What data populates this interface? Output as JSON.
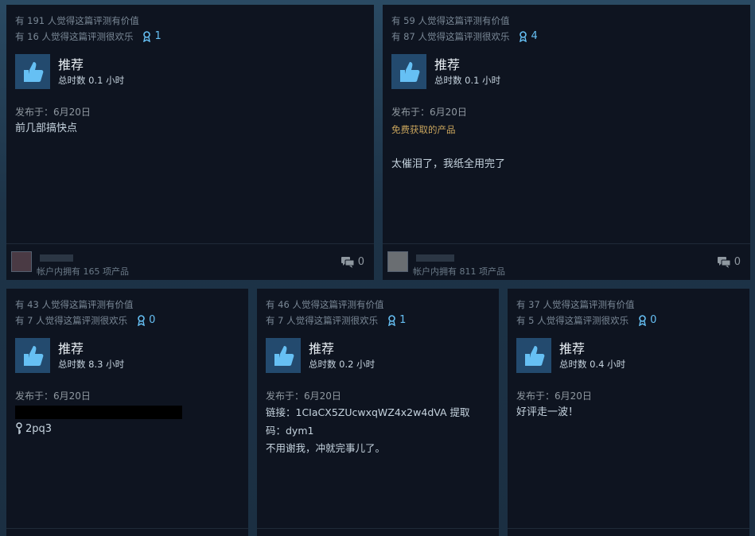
{
  "reviews": [
    {
      "helpful": "有 191 人觉得这篇评测有价值",
      "funny": "有 16 人觉得这篇评测很欢乐",
      "awards": "1",
      "recommendation": "推荐",
      "hours": "总时数 0.1 小时",
      "posted": "发布于：6月20日",
      "body": "前几部搞快点",
      "owned": "帐户内拥有 165 项产品",
      "comments": "0"
    },
    {
      "helpful": "有 59 人觉得这篇评测有价值",
      "funny": "有 87 人觉得这篇评测很欢乐",
      "awards": "4",
      "recommendation": "推荐",
      "hours": "总时数 0.1 小时",
      "posted": "发布于：6月20日",
      "free_label": "免费获取的产品",
      "body": "太催泪了，我纸全用完了",
      "owned": "帐户内拥有 811 项产品",
      "comments": "0"
    },
    {
      "helpful": "有 43 人觉得这篇评测有价值",
      "funny": "有 7 人觉得这篇评测很欢乐",
      "awards": "0",
      "recommendation": "推荐",
      "hours": "总时数 8.3 小时",
      "posted": "发布于：6月20日",
      "key_text": "2pq3"
    },
    {
      "helpful": "有 46 人觉得这篇评测有价值",
      "funny": "有 7 人觉得这篇评测很欢乐",
      "awards": "1",
      "recommendation": "推荐",
      "hours": "总时数 0.2 小时",
      "posted": "发布于：6月20日",
      "body_line1": "链接：1CIaCX5ZUcwxqWZ4x2w4dVA 提取",
      "body_line2": "码：dym1",
      "body_line3": "不用谢我，冲就完事儿了。"
    },
    {
      "helpful": "有 37 人觉得这篇评测有价值",
      "funny": "有 5 人觉得这篇评测很欢乐",
      "awards": "0",
      "recommendation": "推荐",
      "hours": "总时数 0.4 小时",
      "posted": "发布于：6月20日",
      "body": "好评走一波！"
    }
  ],
  "icons": {
    "thumb": "thumbs-up-icon",
    "award": "award-ribbon-icon",
    "comment": "comment-icon",
    "key": "key-icon"
  },
  "colors": {
    "card_bg": "#0e1420",
    "accent": "#66c0f4",
    "thumb_bg": "#234a6e",
    "free_label": "#c8a45c"
  }
}
